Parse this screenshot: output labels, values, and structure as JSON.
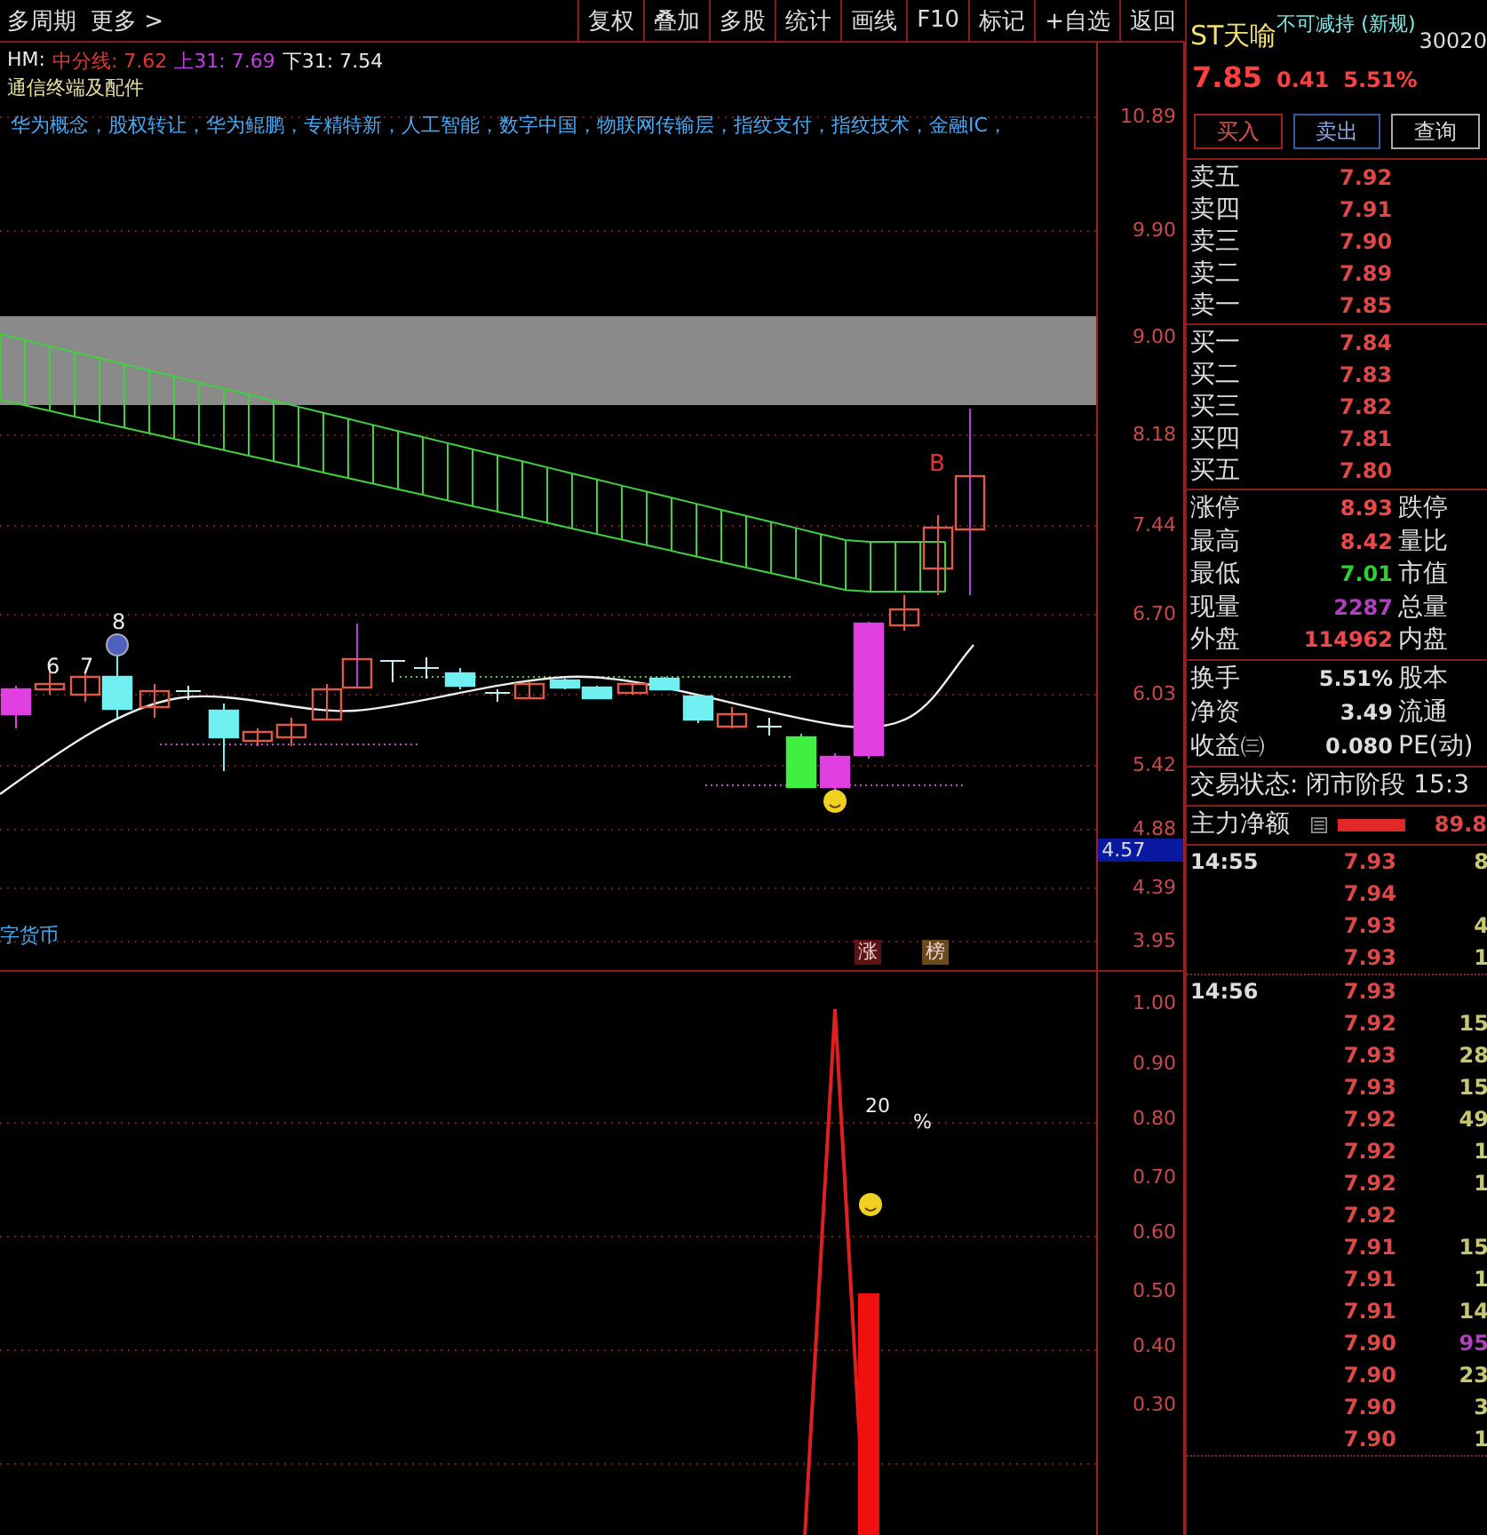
{
  "toolbar": {
    "left": [
      "多周期",
      "更多 >"
    ],
    "buttons": [
      "复权",
      "叠加",
      "多股",
      "统计",
      "画线",
      "F10",
      "标记",
      "+自选",
      "返回"
    ]
  },
  "main_chart": {
    "legend": {
      "name": "HM:",
      "lines": [
        {
          "label": "中分线: 7.62",
          "color": "#e03a2e"
        },
        {
          "label": "上31: 7.69",
          "color": "#c040e0"
        },
        {
          "label": "下31: 7.54",
          "color": "#e8e8e8"
        }
      ]
    },
    "industry": "通信终端及配件",
    "concepts": "华为概念，股权转让，华为鲲鹏，专精特新，人工智能，数字中国，物联网传输层，指纹支付，指纹技术，金融IC，",
    "concepts_tail": "字货币",
    "candle_labels": [
      "6",
      "7",
      "8"
    ],
    "signal_label": "B",
    "markers": [
      {
        "label": "涨",
        "color": "#5a1414"
      },
      {
        "label": "榜",
        "color": "#6a4a1a"
      }
    ],
    "y_axis": [
      "10.89",
      "9.90",
      "9.00",
      "8.18",
      "7.44",
      "6.70",
      "6.03",
      "5.42",
      "4.88",
      "4.39",
      "3.95"
    ],
    "current_tag": "4.57"
  },
  "sub_chart": {
    "labels": [
      "20",
      "%"
    ],
    "y_axis": [
      "1.00",
      "0.90",
      "0.80",
      "0.70",
      "0.60",
      "0.50",
      "0.40",
      "0.30"
    ]
  },
  "quote": {
    "name": "ST天喻",
    "tag": "不可减持 (新规)",
    "code": "30020",
    "price": "7.85",
    "change": "0.41",
    "percent": "5.51%",
    "actions": [
      {
        "label": "买入",
        "kind": "buy"
      },
      {
        "label": "卖出",
        "kind": "sell"
      },
      {
        "label": "查询",
        "kind": "query"
      }
    ],
    "asks": [
      {
        "label": "卖五",
        "price": "7.92"
      },
      {
        "label": "卖四",
        "price": "7.91"
      },
      {
        "label": "卖三",
        "price": "7.90"
      },
      {
        "label": "卖二",
        "price": "7.89"
      },
      {
        "label": "卖一",
        "price": "7.85"
      }
    ],
    "bids": [
      {
        "label": "买一",
        "price": "7.84"
      },
      {
        "label": "买二",
        "price": "7.83"
      },
      {
        "label": "买三",
        "price": "7.82"
      },
      {
        "label": "买四",
        "price": "7.81"
      },
      {
        "label": "买五",
        "price": "7.80"
      }
    ],
    "stats": [
      {
        "label": "涨停",
        "value": "8.93",
        "color": "#f04848",
        "label2": "跌停"
      },
      {
        "label": "最高",
        "value": "8.42",
        "color": "#f04848",
        "label2": "量比"
      },
      {
        "label": "最低",
        "value": "7.01",
        "color": "#30d030",
        "label2": "市值"
      },
      {
        "label": "现量",
        "value": "2287",
        "color": "#b040c0",
        "label2": "总量"
      },
      {
        "label": "外盘",
        "value": "114962",
        "color": "#f04848",
        "label2": "内盘"
      }
    ],
    "fundamentals": [
      {
        "label": "换手",
        "value": "5.51%",
        "label2": "股本"
      },
      {
        "label": "净资",
        "value": "3.49",
        "label2": "流通"
      },
      {
        "label": "收益㈢",
        "value": "0.080",
        "label2": "PE(动)"
      }
    ],
    "status": "交易状态: 闭市阶段 15:3",
    "main_force": {
      "label": "主力净额",
      "value": "89.8"
    },
    "ticks": [
      {
        "rows": [
          {
            "time": "14:55",
            "price": "7.93",
            "volume": "8",
            "color": "#c8c870"
          },
          {
            "price": "7.94"
          },
          {
            "price": "7.93",
            "volume": "4",
            "color": "#c8c870"
          },
          {
            "price": "7.93",
            "volume": "1",
            "color": "#c8c870"
          }
        ]
      },
      {
        "rows": [
          {
            "time": "14:56",
            "price": "7.93"
          },
          {
            "price": "7.92",
            "volume": "15",
            "color": "#c8c870"
          },
          {
            "price": "7.93",
            "volume": "28",
            "color": "#c8c870"
          },
          {
            "price": "7.93",
            "volume": "15",
            "color": "#c8c870"
          },
          {
            "price": "7.92",
            "volume": "49",
            "color": "#c8c870"
          },
          {
            "price": "7.92",
            "volume": "1",
            "color": "#c8c870"
          },
          {
            "price": "7.92",
            "volume": "1",
            "color": "#c8c870"
          },
          {
            "price": "7.92"
          },
          {
            "price": "7.91",
            "volume": "15",
            "color": "#c8c870"
          },
          {
            "price": "7.91",
            "volume": "1",
            "color": "#c8c870"
          },
          {
            "price": "7.91",
            "volume": "14",
            "color": "#c8c870"
          },
          {
            "price": "7.90",
            "volume": "95",
            "color": "#b040c0"
          },
          {
            "price": "7.90",
            "volume": "23",
            "color": "#c8c870"
          },
          {
            "price": "7.90",
            "volume": "3",
            "color": "#c8c870"
          },
          {
            "price": "7.90",
            "volume": "1",
            "color": "#c8c870"
          }
        ]
      }
    ]
  }
}
